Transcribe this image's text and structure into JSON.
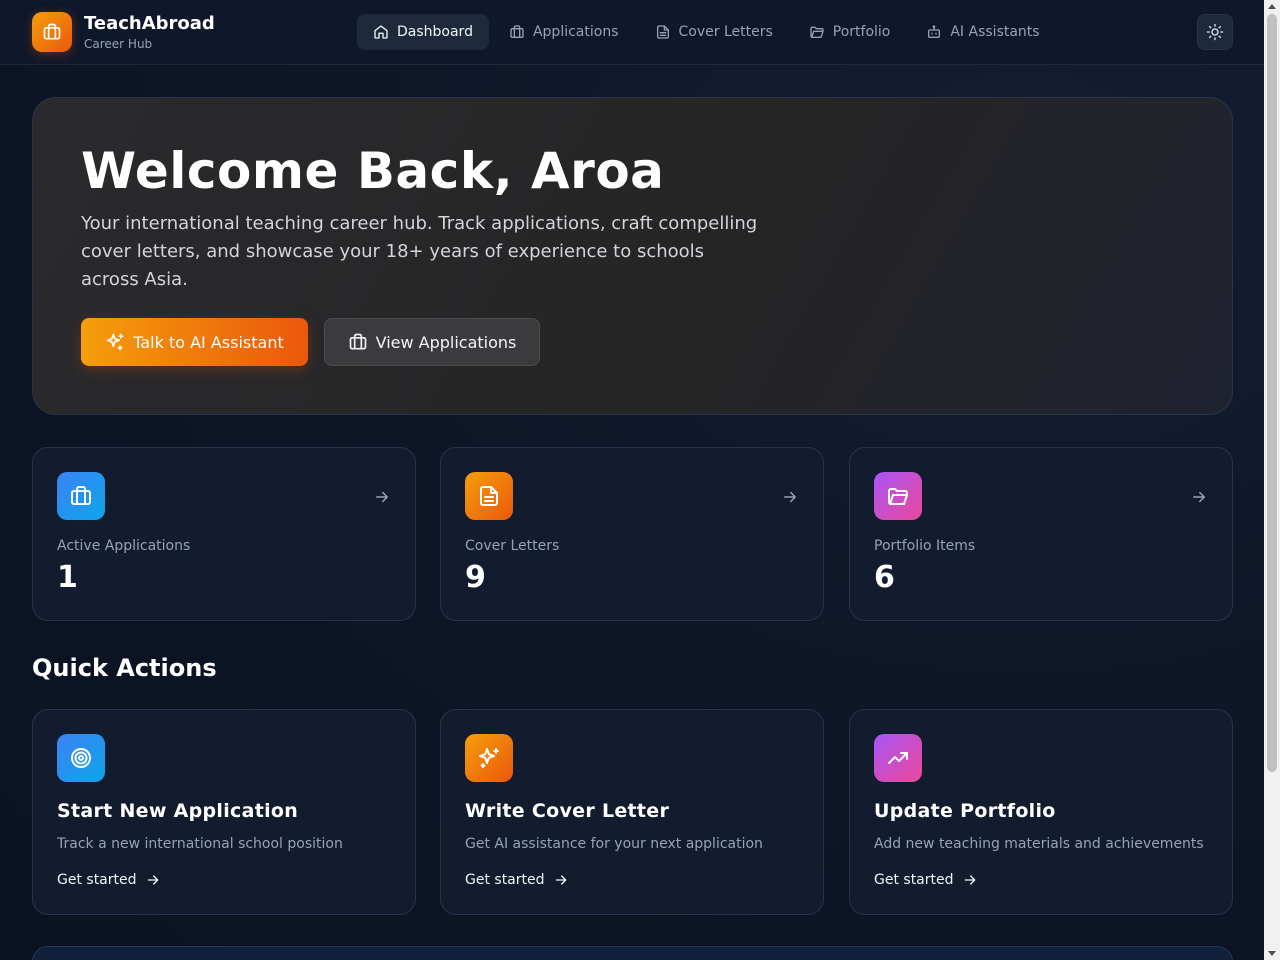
{
  "brand": {
    "name": "TeachAbroad",
    "subtitle": "Career Hub"
  },
  "nav": {
    "items": [
      {
        "label": "Dashboard",
        "icon": "home-icon",
        "active": true
      },
      {
        "label": "Applications",
        "icon": "briefcase-icon",
        "active": false
      },
      {
        "label": "Cover Letters",
        "icon": "document-icon",
        "active": false
      },
      {
        "label": "Portfolio",
        "icon": "folder-open-icon",
        "active": false
      },
      {
        "label": "AI Assistants",
        "icon": "bot-icon",
        "active": false
      }
    ],
    "theme_toggle_icon": "sun-icon"
  },
  "hero": {
    "title": "Welcome Back, Aroa",
    "description": "Your international teaching career hub. Track applications, craft compelling cover letters, and showcase your 18+ years of experience to schools across Asia.",
    "primary_button": "Talk to AI Assistant",
    "secondary_button": "View Applications"
  },
  "stats": [
    {
      "label": "Active Applications",
      "value": "1",
      "icon": "briefcase-icon",
      "color": "#3b82f6"
    },
    {
      "label": "Cover Letters",
      "value": "9",
      "icon": "document-icon",
      "color": "#f59e0b"
    },
    {
      "label": "Portfolio Items",
      "value": "6",
      "icon": "folder-open-icon",
      "color": "#a855f7"
    }
  ],
  "quick_actions": {
    "title": "Quick Actions",
    "items": [
      {
        "title": "Start New Application",
        "description": "Track a new international school position",
        "link": "Get started",
        "icon": "target-icon",
        "color": "#3b82f6"
      },
      {
        "title": "Write Cover Letter",
        "description": "Get AI assistance for your next application",
        "link": "Get started",
        "icon": "sparkles-icon",
        "color": "#f59e0b"
      },
      {
        "title": "Update Portfolio",
        "description": "Add new teaching materials and achievements",
        "link": "Get started",
        "icon": "trending-up-icon",
        "color": "#a855f7"
      }
    ]
  },
  "colors": {
    "accent": "#f97316",
    "background": "#0d1526",
    "card": "#131c2e"
  }
}
